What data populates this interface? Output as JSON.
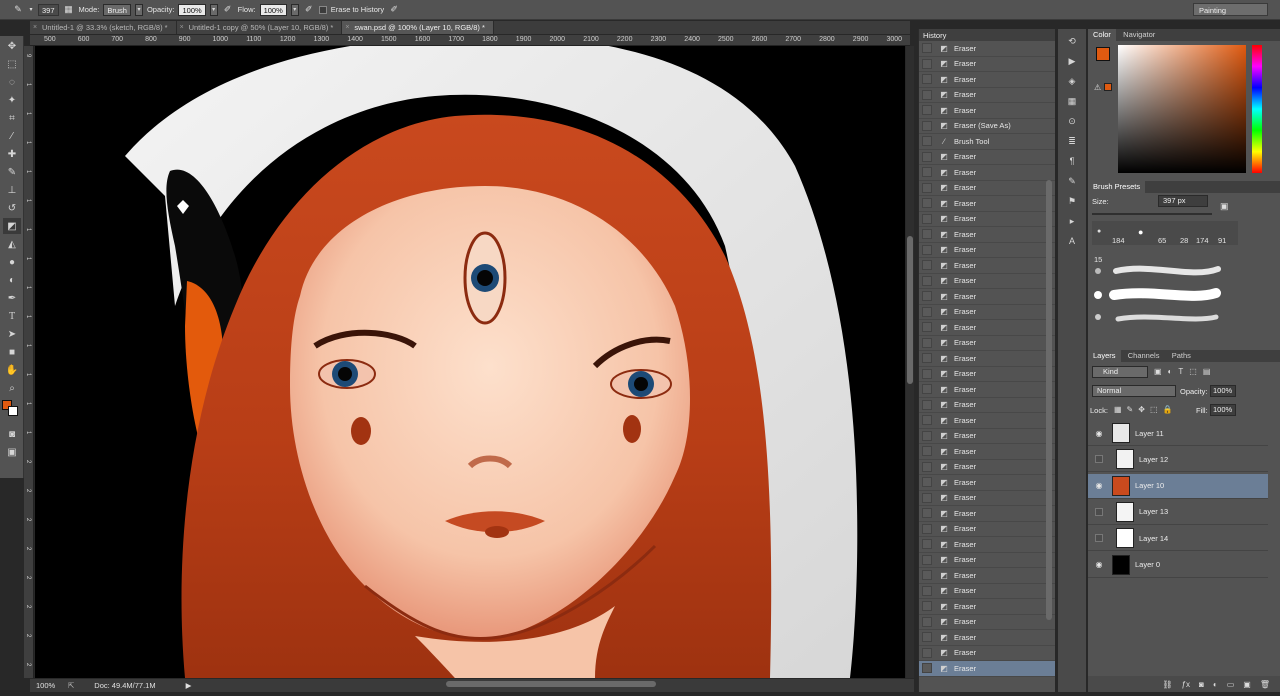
{
  "options_bar": {
    "brush_size": "397",
    "mode_label": "Mode:",
    "mode_value": "Brush",
    "opacity_label": "Opacity:",
    "opacity_value": "100%",
    "flow_label": "Flow:",
    "flow_value": "100%",
    "erase_history_label": "Erase to History",
    "workspace": "Painting"
  },
  "tabs": [
    {
      "label": "Untitled-1 @ 33.3% (sketch, RGB/8) *"
    },
    {
      "label": "Untitled-1 copy @ 50% (Layer 10, RGB/8) *"
    },
    {
      "label": "swan.psd @ 100% (Layer 10, RGB/8) *"
    }
  ],
  "ruler": {
    "h_labels": [
      "500",
      "600",
      "700",
      "800",
      "900",
      "1000",
      "1100",
      "1200",
      "1300",
      "1400",
      "1500",
      "1600",
      "1700",
      "1800",
      "1900",
      "2000",
      "2100",
      "2200",
      "2300",
      "2400",
      "2500",
      "2600",
      "2700",
      "2800",
      "2900",
      "3000"
    ],
    "v_labels": [
      "9",
      "1",
      "1",
      "1",
      "1",
      "1",
      "1",
      "1",
      "1",
      "1",
      "1",
      "1",
      "1",
      "1",
      "2",
      "2",
      "2",
      "2",
      "2",
      "2",
      "2",
      "2"
    ]
  },
  "status": {
    "zoom": "100%",
    "doc": "Doc: 49.4M/77.1M"
  },
  "history": {
    "title": "History",
    "items": [
      {
        "label": "Eraser",
        "icon": "eraser-icon"
      },
      {
        "label": "Eraser",
        "icon": "eraser-icon"
      },
      {
        "label": "Eraser",
        "icon": "eraser-icon"
      },
      {
        "label": "Eraser",
        "icon": "eraser-icon"
      },
      {
        "label": "Eraser",
        "icon": "eraser-icon"
      },
      {
        "label": "Eraser (Save As)",
        "icon": "eraser-icon"
      },
      {
        "label": "Brush Tool",
        "icon": "brush-icon"
      },
      {
        "label": "Eraser",
        "icon": "eraser-icon"
      },
      {
        "label": "Eraser",
        "icon": "eraser-icon"
      },
      {
        "label": "Eraser",
        "icon": "eraser-icon"
      },
      {
        "label": "Eraser",
        "icon": "eraser-icon"
      },
      {
        "label": "Eraser",
        "icon": "eraser-icon"
      },
      {
        "label": "Eraser",
        "icon": "eraser-icon"
      },
      {
        "label": "Eraser",
        "icon": "eraser-icon"
      },
      {
        "label": "Eraser",
        "icon": "eraser-icon"
      },
      {
        "label": "Eraser",
        "icon": "eraser-icon"
      },
      {
        "label": "Eraser",
        "icon": "eraser-icon"
      },
      {
        "label": "Eraser",
        "icon": "eraser-icon"
      },
      {
        "label": "Eraser",
        "icon": "eraser-icon"
      },
      {
        "label": "Eraser",
        "icon": "eraser-icon"
      },
      {
        "label": "Eraser",
        "icon": "eraser-icon"
      },
      {
        "label": "Eraser",
        "icon": "eraser-icon"
      },
      {
        "label": "Eraser",
        "icon": "eraser-icon"
      },
      {
        "label": "Eraser",
        "icon": "eraser-icon"
      },
      {
        "label": "Eraser",
        "icon": "eraser-icon"
      },
      {
        "label": "Eraser",
        "icon": "eraser-icon"
      },
      {
        "label": "Eraser",
        "icon": "eraser-icon"
      },
      {
        "label": "Eraser",
        "icon": "eraser-icon"
      },
      {
        "label": "Eraser",
        "icon": "eraser-icon"
      },
      {
        "label": "Eraser",
        "icon": "eraser-icon"
      },
      {
        "label": "Eraser",
        "icon": "eraser-icon"
      },
      {
        "label": "Eraser",
        "icon": "eraser-icon"
      },
      {
        "label": "Eraser",
        "icon": "eraser-icon"
      },
      {
        "label": "Eraser",
        "icon": "eraser-icon"
      },
      {
        "label": "Eraser",
        "icon": "eraser-icon"
      },
      {
        "label": "Eraser",
        "icon": "eraser-icon"
      },
      {
        "label": "Eraser",
        "icon": "eraser-icon"
      },
      {
        "label": "Eraser",
        "icon": "eraser-icon"
      },
      {
        "label": "Eraser",
        "icon": "eraser-icon"
      },
      {
        "label": "Eraser",
        "icon": "eraser-icon"
      },
      {
        "label": "Eraser",
        "icon": "eraser-icon"
      }
    ]
  },
  "color_panel": {
    "tab_color": "Color",
    "tab_navigator": "Navigator",
    "foreground": "#e05a10",
    "background": "#ffffff"
  },
  "brush_presets": {
    "title": "Brush Presets",
    "size_label": "Size:",
    "size_value": "397 px",
    "sizes": [
      "184",
      "65",
      "28",
      "174",
      "91"
    ],
    "extra_size": "15"
  },
  "layers_panel": {
    "tab_layers": "Layers",
    "tab_channels": "Channels",
    "tab_paths": "Paths",
    "kind": "Kind",
    "blend_mode": "Normal",
    "opacity_label": "Opacity:",
    "opacity_value": "100%",
    "lock_label": "Lock:",
    "fill_label": "Fill:",
    "fill_value": "100%",
    "layers": [
      {
        "name": "Layer 11",
        "visible": true,
        "selected": false
      },
      {
        "name": "Layer 12",
        "visible": false,
        "selected": false
      },
      {
        "name": "Layer 10",
        "visible": true,
        "selected": true
      },
      {
        "name": "Layer 13",
        "visible": false,
        "selected": false
      },
      {
        "name": "Layer 14",
        "visible": false,
        "selected": false
      },
      {
        "name": "Layer 0",
        "visible": true,
        "selected": false
      }
    ]
  }
}
